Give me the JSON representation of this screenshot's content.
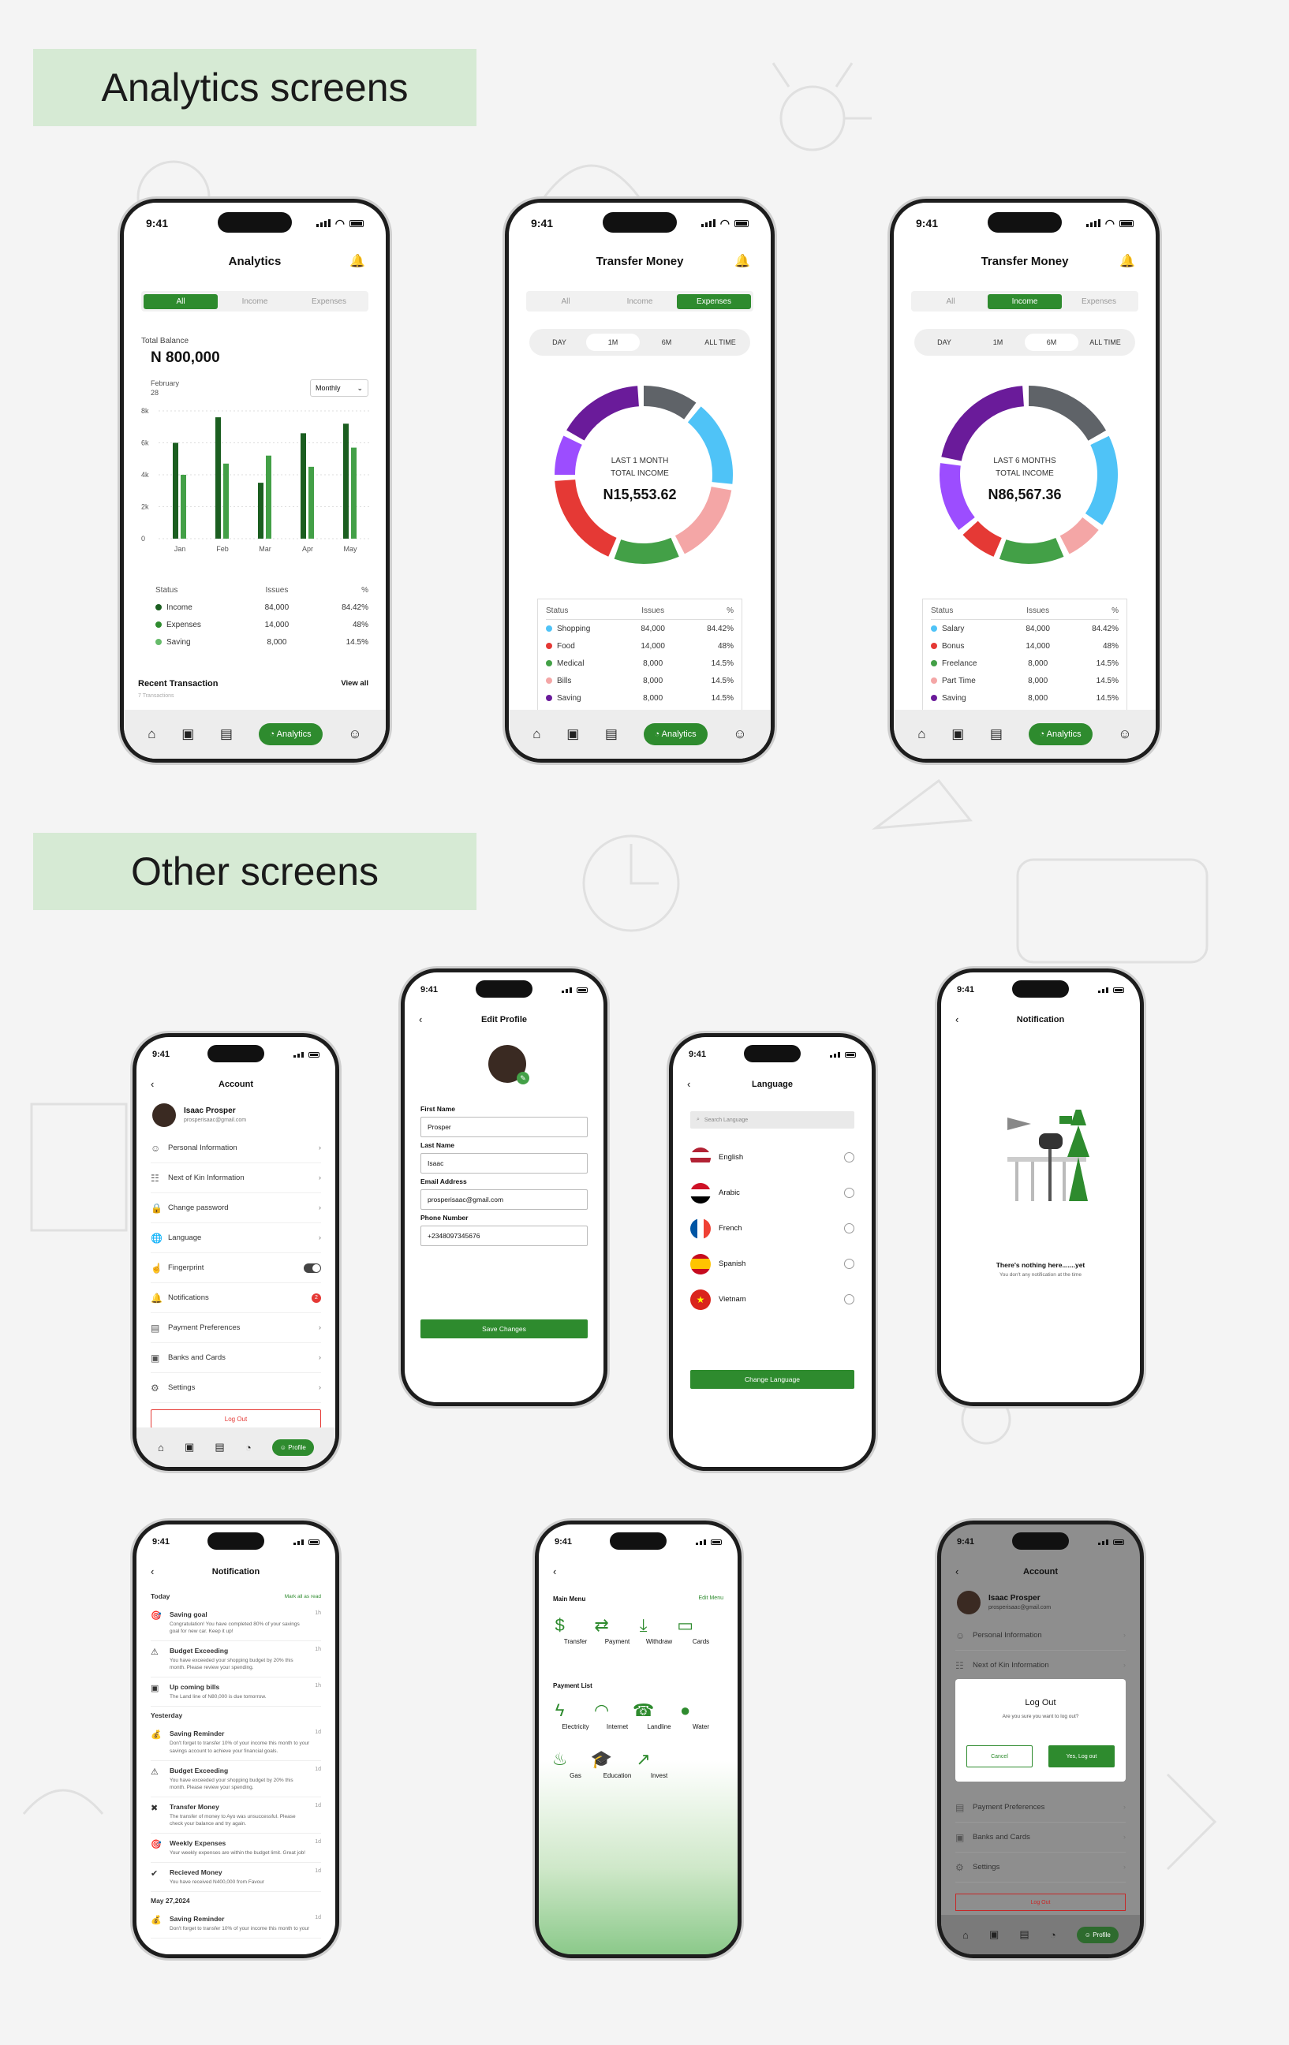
{
  "headings": {
    "analytics": "Analytics screens",
    "other": "Other screens"
  },
  "status_time": "9:41",
  "screen1": {
    "title": "Analytics",
    "tabs": [
      "All",
      "Income",
      "Expenses"
    ],
    "balance_label": "Total Balance",
    "balance": "N 800,000",
    "month": "February",
    "day": "28",
    "period": "Monthly",
    "table_head": [
      "Status",
      "Issues",
      "%"
    ],
    "rows": [
      {
        "name": "Income",
        "issues": "84,000",
        "pct": "84.42%",
        "color": "#1b5e20"
      },
      {
        "name": "Expenses",
        "issues": "14,000",
        "pct": "48%",
        "color": "#2e8b2e"
      },
      {
        "name": "Saving",
        "issues": "8,000",
        "pct": "14.5%",
        "color": "#66bb6a"
      }
    ],
    "recent": "Recent Transaction",
    "view_all": "View all",
    "recent_sub": "7 Transactions",
    "nav_active": "Analytics"
  },
  "chart_data": {
    "type": "bar",
    "categories": [
      "Jan",
      "Feb",
      "Mar",
      "Apr",
      "May"
    ],
    "yticks": [
      "8k",
      "6k",
      "4k",
      "2k",
      "0"
    ],
    "ylim": [
      0,
      8000
    ],
    "series": [
      {
        "values": [
          6000,
          7600,
          3500,
          6600,
          7200
        ]
      },
      {
        "values": [
          4000,
          4700,
          5200,
          4500,
          5700
        ]
      }
    ],
    "colors": [
      "#1b5e20",
      "#43a047"
    ]
  },
  "screen2": {
    "title": "Transfer Money",
    "tabs": [
      "All",
      "Income",
      "Expenses"
    ],
    "periods": [
      "DAY",
      "1M",
      "6M",
      "ALL TIME"
    ],
    "center1": "LAST 1 MONTH",
    "center2": "TOTAL INCOME",
    "amount": "N15,553.62",
    "table_head": [
      "Status",
      "Issues",
      "%"
    ],
    "rows": [
      {
        "name": "Shopping",
        "issues": "84,000",
        "pct": "84.42%",
        "color": "#4fc3f7"
      },
      {
        "name": "Food",
        "issues": "14,000",
        "pct": "48%",
        "color": "#e53935"
      },
      {
        "name": "Medical",
        "issues": "8,000",
        "pct": "14.5%",
        "color": "#43a047"
      },
      {
        "name": "Bills",
        "issues": "8,000",
        "pct": "14.5%",
        "color": "#f4a6a6"
      },
      {
        "name": "Saving",
        "issues": "8,000",
        "pct": "14.5%",
        "color": "#6a1b9a"
      }
    ],
    "nav_active": "Analytics"
  },
  "screen3": {
    "title": "Transfer Money",
    "tabs": [
      "All",
      "Income",
      "Expenses"
    ],
    "periods": [
      "DAY",
      "1M",
      "6M",
      "ALL TIME"
    ],
    "center1": "LAST 6 MONTHS",
    "center2": "TOTAL INCOME",
    "amount": "N86,567.36",
    "table_head": [
      "Status",
      "Issues",
      "%"
    ],
    "rows": [
      {
        "name": "Salary",
        "issues": "84,000",
        "pct": "84.42%",
        "color": "#4fc3f7"
      },
      {
        "name": "Bonus",
        "issues": "14,000",
        "pct": "48%",
        "color": "#e53935"
      },
      {
        "name": "Freelance",
        "issues": "8,000",
        "pct": "14.5%",
        "color": "#43a047"
      },
      {
        "name": "Part Time",
        "issues": "8,000",
        "pct": "14.5%",
        "color": "#f4a6a6"
      },
      {
        "name": "Saving",
        "issues": "8,000",
        "pct": "14.5%",
        "color": "#6a1b9a"
      }
    ],
    "nav_active": "Analytics"
  },
  "account": {
    "title": "Account",
    "name": "Isaac Prosper",
    "email": "prosperisaac@gmail.com",
    "items": [
      "Personal Information",
      "Next of Kin Information",
      "Change password",
      "Language",
      "Fingerprint",
      "Notifications",
      "Payment Preferences",
      "Banks and Cards",
      "Settings"
    ],
    "logout": "Log Out",
    "nav_active": "Profile",
    "badge": "2"
  },
  "edit": {
    "title": "Edit Profile",
    "fields": [
      {
        "label": "First Name",
        "value": "Prosper"
      },
      {
        "label": "Last Name",
        "value": "Isaac"
      },
      {
        "label": "Email Address",
        "value": "prosperisaac@gmail.com"
      },
      {
        "label": "Phone Number",
        "value": "+2348097345676"
      }
    ],
    "save": "Save Changes"
  },
  "language": {
    "title": "Language",
    "search": "Search Language",
    "items": [
      "English",
      "Arabic",
      "French",
      "Spanish",
      "Vietnam"
    ],
    "button": "Change Language"
  },
  "empty": {
    "title": "Notification",
    "line1": "There's nothing here.......yet",
    "line2": "You don't any notification at the time"
  },
  "notif": {
    "title": "Notification",
    "today": "Today",
    "mark": "Mark all as read",
    "yesterday": "Yesterday",
    "date": "May 27,2024",
    "items": [
      {
        "t": "Saving goal",
        "d": "Congratulation! You have completed 80% of your savings goal for new car. Keep it up!",
        "tm": "1h"
      },
      {
        "t": "Budget Exceeding",
        "d": "You have exceeded your shopping budget by 20% this month. Please review your spending.",
        "tm": "1h"
      },
      {
        "t": "Up coming bills",
        "d": "The Land line of N80,000 is due tomorrow.",
        "tm": "1h"
      },
      {
        "t": "Saving Reminder",
        "d": "Don't forget to transfer 10% of your income this month to your savings account to achieve your financial goals.",
        "tm": "1d"
      },
      {
        "t": "Budget Exceeding",
        "d": "You have exceeded your shopping budget by 20% this month. Please review your spending.",
        "tm": "1d"
      },
      {
        "t": "Transfer Money",
        "d": "The transfer of money to Ayo was unsuccessful. Please check your balance and try again.",
        "tm": "1d"
      },
      {
        "t": "Weekly Expenses",
        "d": "Your weekly expenses are within the budget limit. Great job!",
        "tm": "1d"
      },
      {
        "t": "Recieved Money",
        "d": "You have received N400,000 from Favour",
        "tm": "1d"
      },
      {
        "t": "Saving Reminder",
        "d": "Don't forget to transfer 10% of your income this month to your",
        "tm": "1d"
      }
    ]
  },
  "menu": {
    "main": "Main Menu",
    "edit": "Edit Menu",
    "main_items": [
      "Transfer",
      "Payment",
      "Withdraw",
      "Cards"
    ],
    "pay": "Payment List",
    "pay_items": [
      "Electricity",
      "Internet",
      "Landline",
      "Water",
      "Gas",
      "Education",
      "Invest"
    ]
  },
  "logoutdlg": {
    "title": "Account",
    "name": "Isaac Prosper",
    "email": "prosperisaac@gmail.com",
    "items_top": [
      "Personal Information",
      "Next of Kin Information"
    ],
    "items_bottom": [
      "Payment Preferences",
      "Banks and Cards",
      "Settings"
    ],
    "dlg_title": "Log Out",
    "dlg_text": "Are you sure you want to log out?",
    "cancel": "Cancel",
    "confirm": "Yes, Log out",
    "logout": "Log Out",
    "nav_active": "Profile"
  }
}
